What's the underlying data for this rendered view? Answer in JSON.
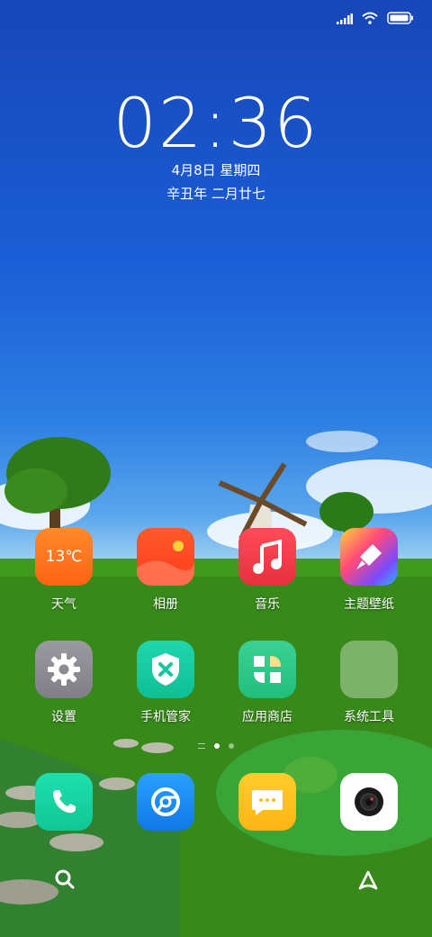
{
  "status_bar": {
    "icons": [
      "signal-icon",
      "wifi-icon",
      "battery-icon"
    ]
  },
  "lockclock": {
    "time": "02:36",
    "date": "4月8日 星期四",
    "lunar": "辛丑年 二月廿七"
  },
  "apps_row1": [
    {
      "label": "天气",
      "icon": "weather-icon",
      "temp": "13℃"
    },
    {
      "label": "相册",
      "icon": "gallery-icon"
    },
    {
      "label": "音乐",
      "icon": "music-icon"
    },
    {
      "label": "主题壁纸",
      "icon": "themes-icon"
    }
  ],
  "apps_row2": [
    {
      "label": "设置",
      "icon": "settings-icon"
    },
    {
      "label": "手机管家",
      "icon": "security-icon"
    },
    {
      "label": "应用商店",
      "icon": "app-store-icon"
    },
    {
      "label": "系统工具",
      "icon": "folder-icon"
    }
  ],
  "dock": [
    {
      "icon": "phone-icon"
    },
    {
      "icon": "browser-icon"
    },
    {
      "icon": "messages-icon"
    },
    {
      "icon": "camera-icon"
    }
  ],
  "colors": {
    "weather": "#ff6a1a",
    "gallery": "#ff4a22",
    "music": "#f0394a",
    "settings": "#8e8e93",
    "security": "#14c9a0",
    "store": "#2fc98a",
    "phone": "#12d4a0",
    "browser": "#1a8cf0",
    "messages": "#ffc21a",
    "camera": "#ffffff"
  }
}
